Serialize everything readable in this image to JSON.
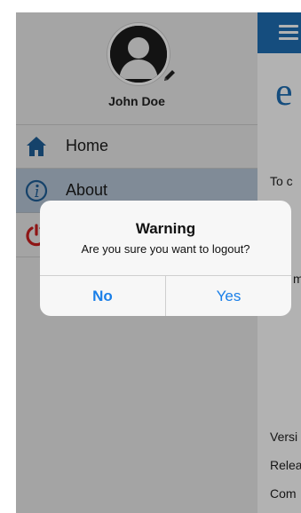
{
  "profile": {
    "name": "John Doe",
    "avatar_icon": "user-silhouette-icon",
    "edit_icon": "pencil-icon"
  },
  "menu": {
    "items": [
      {
        "label": "Home",
        "icon": "home-icon",
        "active": false
      },
      {
        "label": "About",
        "icon": "info-icon",
        "active": true
      },
      {
        "label": "",
        "icon": "logout-icon",
        "active": false
      }
    ]
  },
  "main": {
    "menu_icon": "hamburger-icon",
    "logo_glyph": "e",
    "text_lines": [
      "To c",
      "m",
      "Versi",
      "Relea",
      "Com"
    ]
  },
  "dialog": {
    "title": "Warning",
    "message": "Are you sure you want to logout?",
    "no_label": "No",
    "yes_label": "Yes"
  },
  "colors": {
    "brand_blue": "#1f6fb5",
    "link_blue": "#1a7fe8",
    "logout_red": "#cc1f1f"
  }
}
